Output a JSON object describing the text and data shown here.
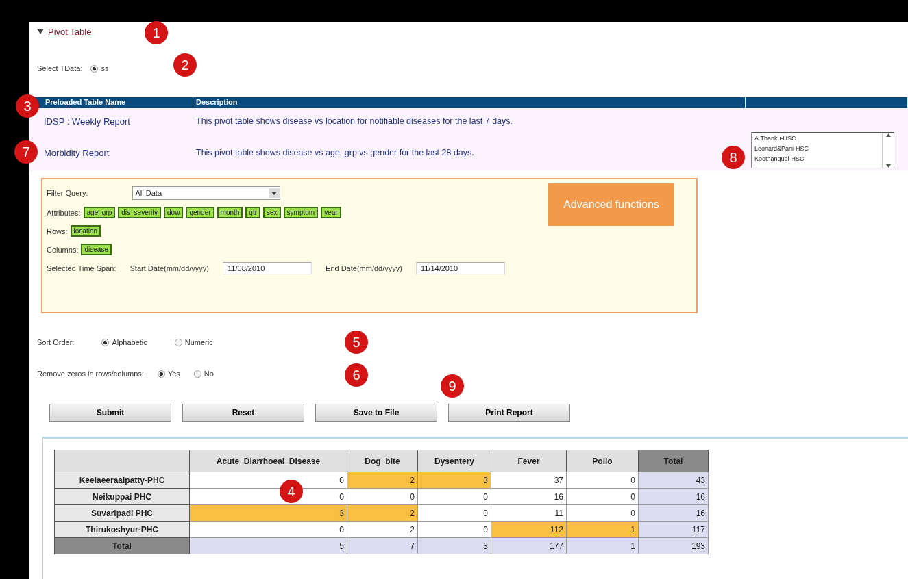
{
  "section": {
    "title": "Pivot Table",
    "expanded": true
  },
  "data_select": {
    "label": "Select TData:",
    "options": [
      {
        "label": "ss",
        "selected": true
      }
    ]
  },
  "preloaded": {
    "columns": [
      "Preloaded Table Name",
      "Description"
    ],
    "rows": [
      {
        "name": "IDSP : Weekly Report",
        "description": "This pivot table shows disease vs location for notifiable diseases for the last 7 days."
      },
      {
        "name": "Morbidity Report",
        "description": "This pivot table shows disease vs age_grp vs gender for the last 28 days."
      }
    ]
  },
  "location_list": [
    "A.Thanku-HSC",
    "Leonard&Pani-HSC",
    "Koothangudi-HSC"
  ],
  "filter": {
    "query_label": "Filter Query:",
    "query_value": "All Data",
    "attributes_label": "Attributes:",
    "attributes": [
      "age_grp",
      "dis_severity",
      "dow",
      "gender",
      "month",
      "qtr",
      "sex",
      "symptom",
      "year"
    ],
    "rows_label": "Rows:",
    "rows": [
      "location"
    ],
    "columns_label": "Columns:",
    "columns": [
      "disease"
    ],
    "time_label": "Selected Time Span:",
    "start_label": "Start Date(mm/dd/yyyy)",
    "start_value": "11/08/2010",
    "end_label": "End Date(mm/dd/yyyy)",
    "end_value": "11/14/2010",
    "advanced": "Advanced functions"
  },
  "sort_order": {
    "label": "Sort Order:",
    "options": [
      {
        "label": "Alphabetic",
        "selected": true
      },
      {
        "label": "Numeric",
        "selected": false
      }
    ]
  },
  "remove_zeros": {
    "label": "Remove zeros in rows/columns:",
    "options": [
      {
        "label": "Yes",
        "selected": true
      },
      {
        "label": "No",
        "selected": false
      }
    ]
  },
  "buttons": [
    "Submit",
    "Reset",
    "Save to File",
    "Print Report"
  ],
  "pivot": {
    "columns": [
      "Acute_Diarrhoeal_Disease",
      "Dog_bite",
      "Dysentery",
      "Fever",
      "Polio",
      "Total"
    ],
    "rows": [
      {
        "kind": "data",
        "label": "Keelaeeraalpatty-PHC",
        "cells": [
          {
            "value": "0",
            "highlight": false
          },
          {
            "value": "2",
            "highlight": true
          },
          {
            "value": "3",
            "highlight": true
          },
          {
            "value": "37",
            "highlight": false
          },
          {
            "value": "0",
            "highlight": false
          },
          {
            "value": "43",
            "highlight": false
          }
        ]
      },
      {
        "kind": "data",
        "label": "Neikuppai PHC",
        "cells": [
          {
            "value": "0",
            "highlight": false
          },
          {
            "value": "0",
            "highlight": false
          },
          {
            "value": "0",
            "highlight": false
          },
          {
            "value": "16",
            "highlight": false
          },
          {
            "value": "0",
            "highlight": false
          },
          {
            "value": "16",
            "highlight": false
          }
        ]
      },
      {
        "kind": "data",
        "label": "Suvaripadi PHC",
        "cells": [
          {
            "value": "3",
            "highlight": true
          },
          {
            "value": "2",
            "highlight": true
          },
          {
            "value": "0",
            "highlight": false
          },
          {
            "value": "11",
            "highlight": false
          },
          {
            "value": "0",
            "highlight": false
          },
          {
            "value": "16",
            "highlight": false
          }
        ]
      },
      {
        "kind": "data",
        "label": "Thirukoshyur-PHC",
        "cells": [
          {
            "value": "0",
            "highlight": false
          },
          {
            "value": "2",
            "highlight": false
          },
          {
            "value": "0",
            "highlight": false
          },
          {
            "value": "112",
            "highlight": true
          },
          {
            "value": "1",
            "highlight": true
          },
          {
            "value": "117",
            "highlight": false
          }
        ]
      },
      {
        "kind": "total",
        "label": "Total",
        "cells": [
          {
            "value": "5",
            "highlight": false
          },
          {
            "value": "7",
            "highlight": false
          },
          {
            "value": "3",
            "highlight": false
          },
          {
            "value": "177",
            "highlight": false
          },
          {
            "value": "1",
            "highlight": false
          },
          {
            "value": "193",
            "highlight": false
          }
        ]
      }
    ]
  },
  "callouts": [
    "1",
    "2",
    "3",
    "7",
    "8",
    "5",
    "6",
    "9",
    "4"
  ]
}
